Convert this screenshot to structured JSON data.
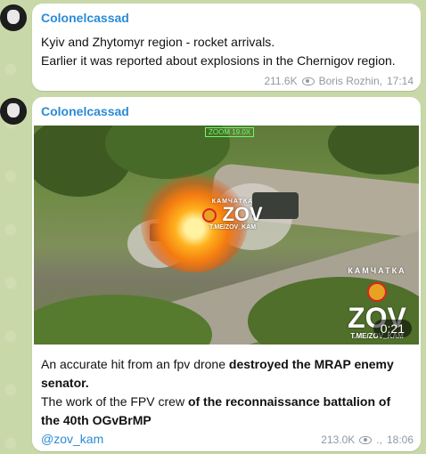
{
  "messages": [
    {
      "sender": "Colonelcassad",
      "lines": [
        "Kyiv and Zhytomyr region - rocket arrivals.",
        "Earlier it was reported about explosions in the Chernigov region."
      ],
      "views": "211.6K",
      "author": "Boris Rozhin,",
      "time": "17:14"
    },
    {
      "sender": "Colonelcassad",
      "media": {
        "duration": "0:21",
        "watermark_center": {
          "word": "ZOV",
          "handle": "T.ME/ZOV_KAM",
          "top": "КАМЧАТКА"
        },
        "watermark_corner": {
          "top": "КАМЧАТКА",
          "word": "ZOV",
          "handle": "T.ME/ZOV_KAM"
        },
        "zoom_label": "ZOOM 19.0X"
      },
      "text": {
        "p1_plain": "An accurate hit from an fpv drone ",
        "p1_bold": "destroyed the MRAP enemy senator.",
        "p2_plain": "The work of the FPV crew ",
        "p2_bold": "of the reconnaissance battalion of the 40th OGvBrMP",
        "link": "@zov_kam"
      },
      "views": "213.0K",
      "author": ".,",
      "time": "18:06"
    }
  ],
  "colors": {
    "accent": "#2b8bd6",
    "bubble": "#ffffff",
    "background": "#c9d8a8"
  }
}
